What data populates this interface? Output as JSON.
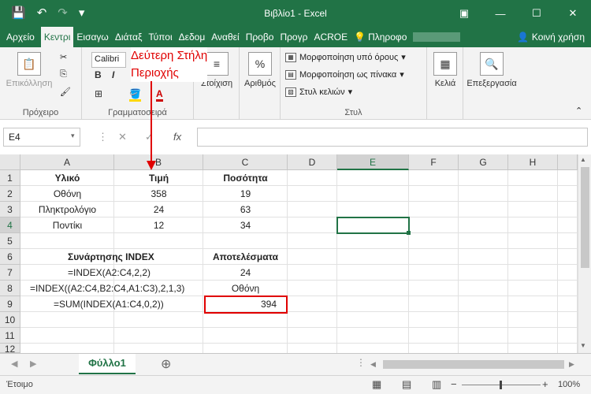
{
  "window": {
    "title": "Βιβλίο1 - Excel"
  },
  "menu": {
    "tabs": [
      "Αρχείο",
      "Κεντρι",
      "Εισαγω",
      "Διάταξ",
      "Τύποι",
      "Δεδομ",
      "Αναθεί",
      "Προβο",
      "Προγρ",
      "ACROE"
    ],
    "search": "Πληροφο",
    "share": "Κοινή χρήση"
  },
  "ribbon": {
    "paste": "Επικόλληση",
    "clipboard": "Πρόχειρο",
    "font_name": "Calibri",
    "font_group": "Γραμματοσειρά",
    "alignment": "Στοίχιση",
    "number": "Αριθμός",
    "conditional": "Μορφοποίηση υπό όρους",
    "as_table": "Μορφοποίηση ως πίνακα",
    "cell_styles": "Στυλ κελιών",
    "styles_group": "Στυλ",
    "cells": "Κελιά",
    "editing": "Επεξεργασία"
  },
  "annotation": {
    "line1": "Δεύτερη Στήλη",
    "line2": "Περιοχής"
  },
  "formula_bar": {
    "name_box": "E4",
    "fx": "fx",
    "formula": ""
  },
  "grid": {
    "columns": [
      "A",
      "B",
      "C",
      "D",
      "E",
      "F",
      "G",
      "H"
    ],
    "rows": [
      "1",
      "2",
      "3",
      "4",
      "5",
      "6",
      "7",
      "8",
      "9",
      "10",
      "11",
      "12"
    ],
    "cells": {
      "A1": "Υλικό",
      "B1": "Τιμή",
      "C1": "Ποσότητα",
      "A2": "Οθόνη",
      "B2": "358",
      "C2": "19",
      "A3": "Πληκτρολόγιο",
      "B3": "24",
      "C3": "63",
      "A4": "Ποντίκι",
      "B4": "12",
      "C4": "34",
      "A6": "Συνάρτησης INDEX",
      "C6": "Αποτελέσματα",
      "A7": "=INDEX(A2:C4,2,2)",
      "C7": "24",
      "A8": "=INDEX((A2:C4,B2:C4,A1:C3),2,1,3)",
      "C8": "Οθόνη",
      "A9": "=SUM(INDEX(A1:C4,0,2))",
      "C9": "394"
    }
  },
  "sheet": {
    "tab": "Φύλλο1",
    "add": "⊕"
  },
  "status": {
    "ready": "Έτοιμο",
    "zoom": "100%"
  }
}
